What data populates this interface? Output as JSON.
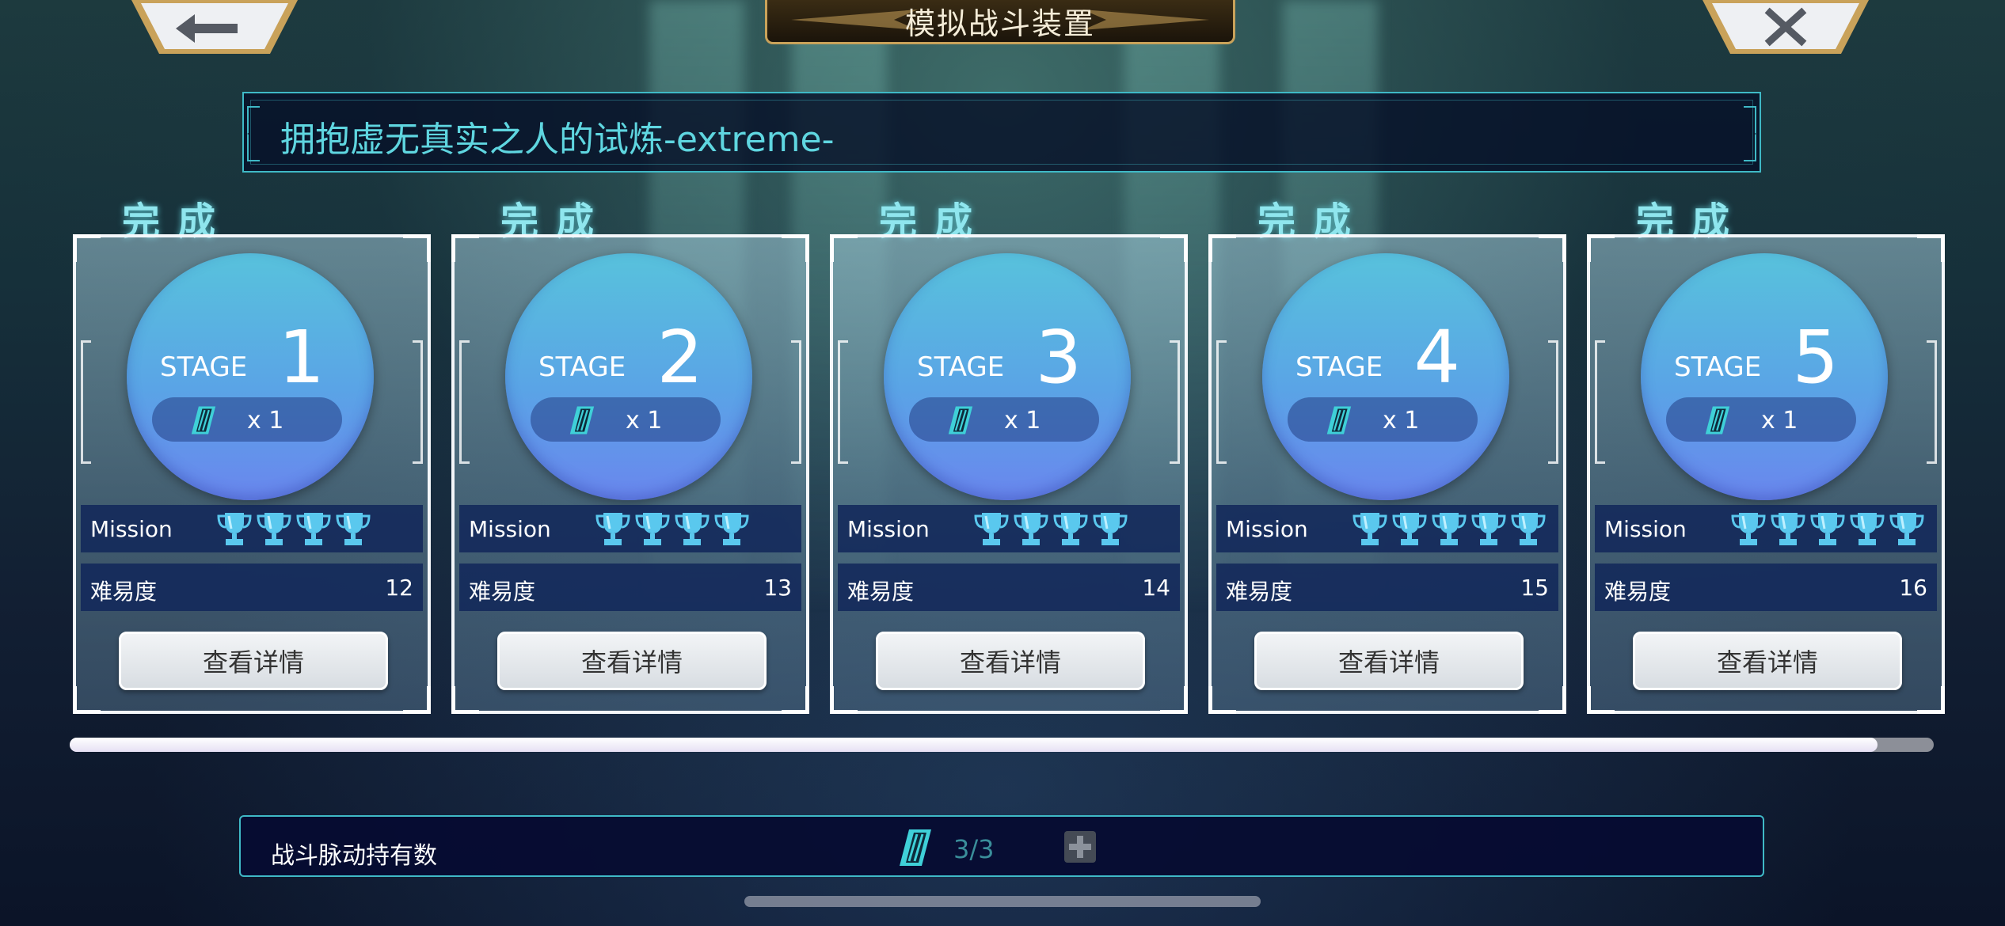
{
  "header": {
    "title": "模拟战斗装置",
    "back_icon": "arrow-left-icon",
    "close_icon": "close-icon"
  },
  "stage_name": "拥抱虚无真实之人的试炼-extreme-",
  "stages": [
    {
      "complete_label": "完成",
      "stage_label": "STAGE",
      "number": "1",
      "ticket_count": "x 1",
      "mission_label": "Mission",
      "trophies": 4,
      "difficulty_label": "难易度",
      "difficulty": "12",
      "button_label": "查看详情"
    },
    {
      "complete_label": "完成",
      "stage_label": "STAGE",
      "number": "2",
      "ticket_count": "x 1",
      "mission_label": "Mission",
      "trophies": 4,
      "difficulty_label": "难易度",
      "difficulty": "13",
      "button_label": "查看详情"
    },
    {
      "complete_label": "完成",
      "stage_label": "STAGE",
      "number": "3",
      "ticket_count": "x 1",
      "mission_label": "Mission",
      "trophies": 4,
      "difficulty_label": "难易度",
      "difficulty": "14",
      "button_label": "查看详情"
    },
    {
      "complete_label": "完成",
      "stage_label": "STAGE",
      "number": "4",
      "ticket_count": "x 1",
      "mission_label": "Mission",
      "trophies": 5,
      "difficulty_label": "难易度",
      "difficulty": "15",
      "button_label": "查看详情"
    },
    {
      "complete_label": "完成",
      "stage_label": "STAGE",
      "number": "5",
      "ticket_count": "x 1",
      "mission_label": "Mission",
      "trophies": 5,
      "difficulty_label": "难易度",
      "difficulty": "16",
      "button_label": "查看详情"
    }
  ],
  "scroll": {
    "visible_fraction": 0.97
  },
  "footer": {
    "holdings_label": "战斗脉动持有数",
    "holdings_value": "3/3",
    "ticket_icon": "battle-ticket-icon",
    "plus_icon": "plus-icon"
  },
  "colors": {
    "accent": "#3fb9c6",
    "circle_top": "#58c2dc",
    "circle_bottom": "#6a86ee",
    "trophy": "#5ac8ee",
    "title_gold": "#c9a25a"
  }
}
